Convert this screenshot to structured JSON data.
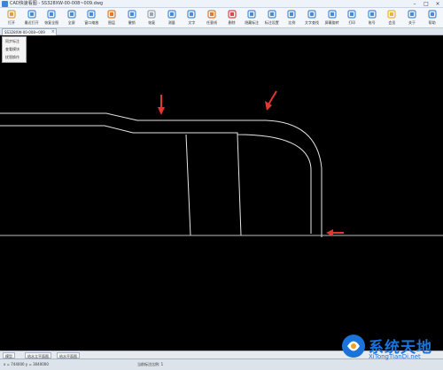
{
  "window": {
    "title": "CAD快速看图 - SS328XW-00-008~009.dwg"
  },
  "toolbar": {
    "items": [
      {
        "label": "打开",
        "icon": "folder-open-icon",
        "color": "#d9a43b"
      },
      {
        "label": "最近打开",
        "icon": "recent-files-icon",
        "color": "#4a8bd6"
      },
      {
        "label": "恢复全图",
        "icon": "zoom-extents-icon",
        "color": "#4a8bd6"
      },
      {
        "label": "全屏",
        "icon": "fullscreen-icon",
        "color": "#4a8bd6"
      },
      {
        "label": "窗口缩放",
        "icon": "zoom-window-icon",
        "color": "#4a8bd6"
      },
      {
        "label": "图层",
        "icon": "layers-icon",
        "color": "#e07b2a"
      },
      {
        "label": "撤销",
        "icon": "undo-icon",
        "color": "#4a8bd6"
      },
      {
        "label": "恢复",
        "icon": "redo-icon",
        "color": "#9aa5b1"
      },
      {
        "label": "测量",
        "icon": "measure-icon",
        "color": "#4a8bd6"
      },
      {
        "label": "文字",
        "icon": "text-icon",
        "color": "#4a8bd6"
      },
      {
        "label": "任意线",
        "icon": "freeline-icon",
        "color": "#e07b2a"
      },
      {
        "label": "删除",
        "icon": "delete-icon",
        "color": "#d94a4a"
      },
      {
        "label": "隐藏标注",
        "icon": "hide-annotation-icon",
        "color": "#4a8bd6"
      },
      {
        "label": "标注设置",
        "icon": "annotation-settings-icon",
        "color": "#4a8bd6"
      },
      {
        "label": "比例",
        "icon": "scale-icon",
        "color": "#4a8bd6"
      },
      {
        "label": "文字查找",
        "icon": "find-text-icon",
        "color": "#4a8bd6"
      },
      {
        "label": "屏幕旋转",
        "icon": "rotate-screen-icon",
        "color": "#4a8bd6"
      },
      {
        "label": "打印",
        "icon": "print-icon",
        "color": "#4a8bd6"
      },
      {
        "label": "账号",
        "icon": "account-icon",
        "color": "#4a8bd6"
      },
      {
        "label": "会员",
        "icon": "vip-icon",
        "color": "#e8b830"
      },
      {
        "label": "关于",
        "icon": "about-icon",
        "color": "#4a8bd6"
      },
      {
        "label": "帮助",
        "icon": "help-icon",
        "color": "#4a8bd6"
      }
    ]
  },
  "document_tab": {
    "name": "SS328XW-00-008~009"
  },
  "context_menu": {
    "items": [
      "同步标注",
      "查看模块",
      "扰恩换作"
    ]
  },
  "layout_tabs": [
    "模型",
    "给水立平面图",
    "给水平面图"
  ],
  "status": {
    "coords": "x = 744000  y = 3040000",
    "scale": "当前标注比例: 1"
  },
  "watermark": {
    "main": "系统天地",
    "url": "XiTongTianDi.net"
  },
  "colors": {
    "canvas_bg": "#000000",
    "drawing_line": "#e6e6e6",
    "annotation_arrow": "#e0372f",
    "toolbar_bg": "#f3f6fa",
    "brand_blue": "#1a73d9"
  }
}
